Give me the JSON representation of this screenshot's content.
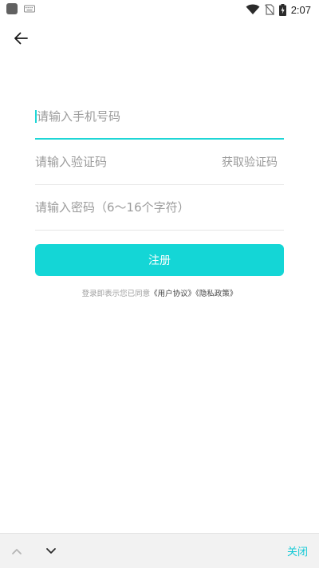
{
  "status_bar": {
    "time": "2:07",
    "icons": [
      "app-square-icon",
      "keyboard-icon",
      "wifi-icon",
      "no-sim-icon",
      "battery-charging-icon"
    ]
  },
  "header": {
    "back_icon": "arrow-left-icon"
  },
  "form": {
    "phone": {
      "placeholder": "请输入手机号码",
      "value": ""
    },
    "code": {
      "placeholder": "请输入验证码",
      "value": "",
      "get_code_label": "获取验证码"
    },
    "password": {
      "placeholder": "请输入密码（6～16个字符）",
      "value": ""
    },
    "register_label": "注册",
    "agreement": {
      "prefix": "登录即表示您已同意",
      "user_agreement": "《用户协议》",
      "privacy_policy": "《隐私政策》"
    }
  },
  "keyboard_bar": {
    "close_label": "关闭",
    "up_icon": "chevron-up-icon",
    "down_icon": "chevron-down-icon"
  },
  "colors": {
    "accent": "#14d6d6",
    "close_text": "#14c9d6",
    "placeholder": "#9b9b9b"
  }
}
